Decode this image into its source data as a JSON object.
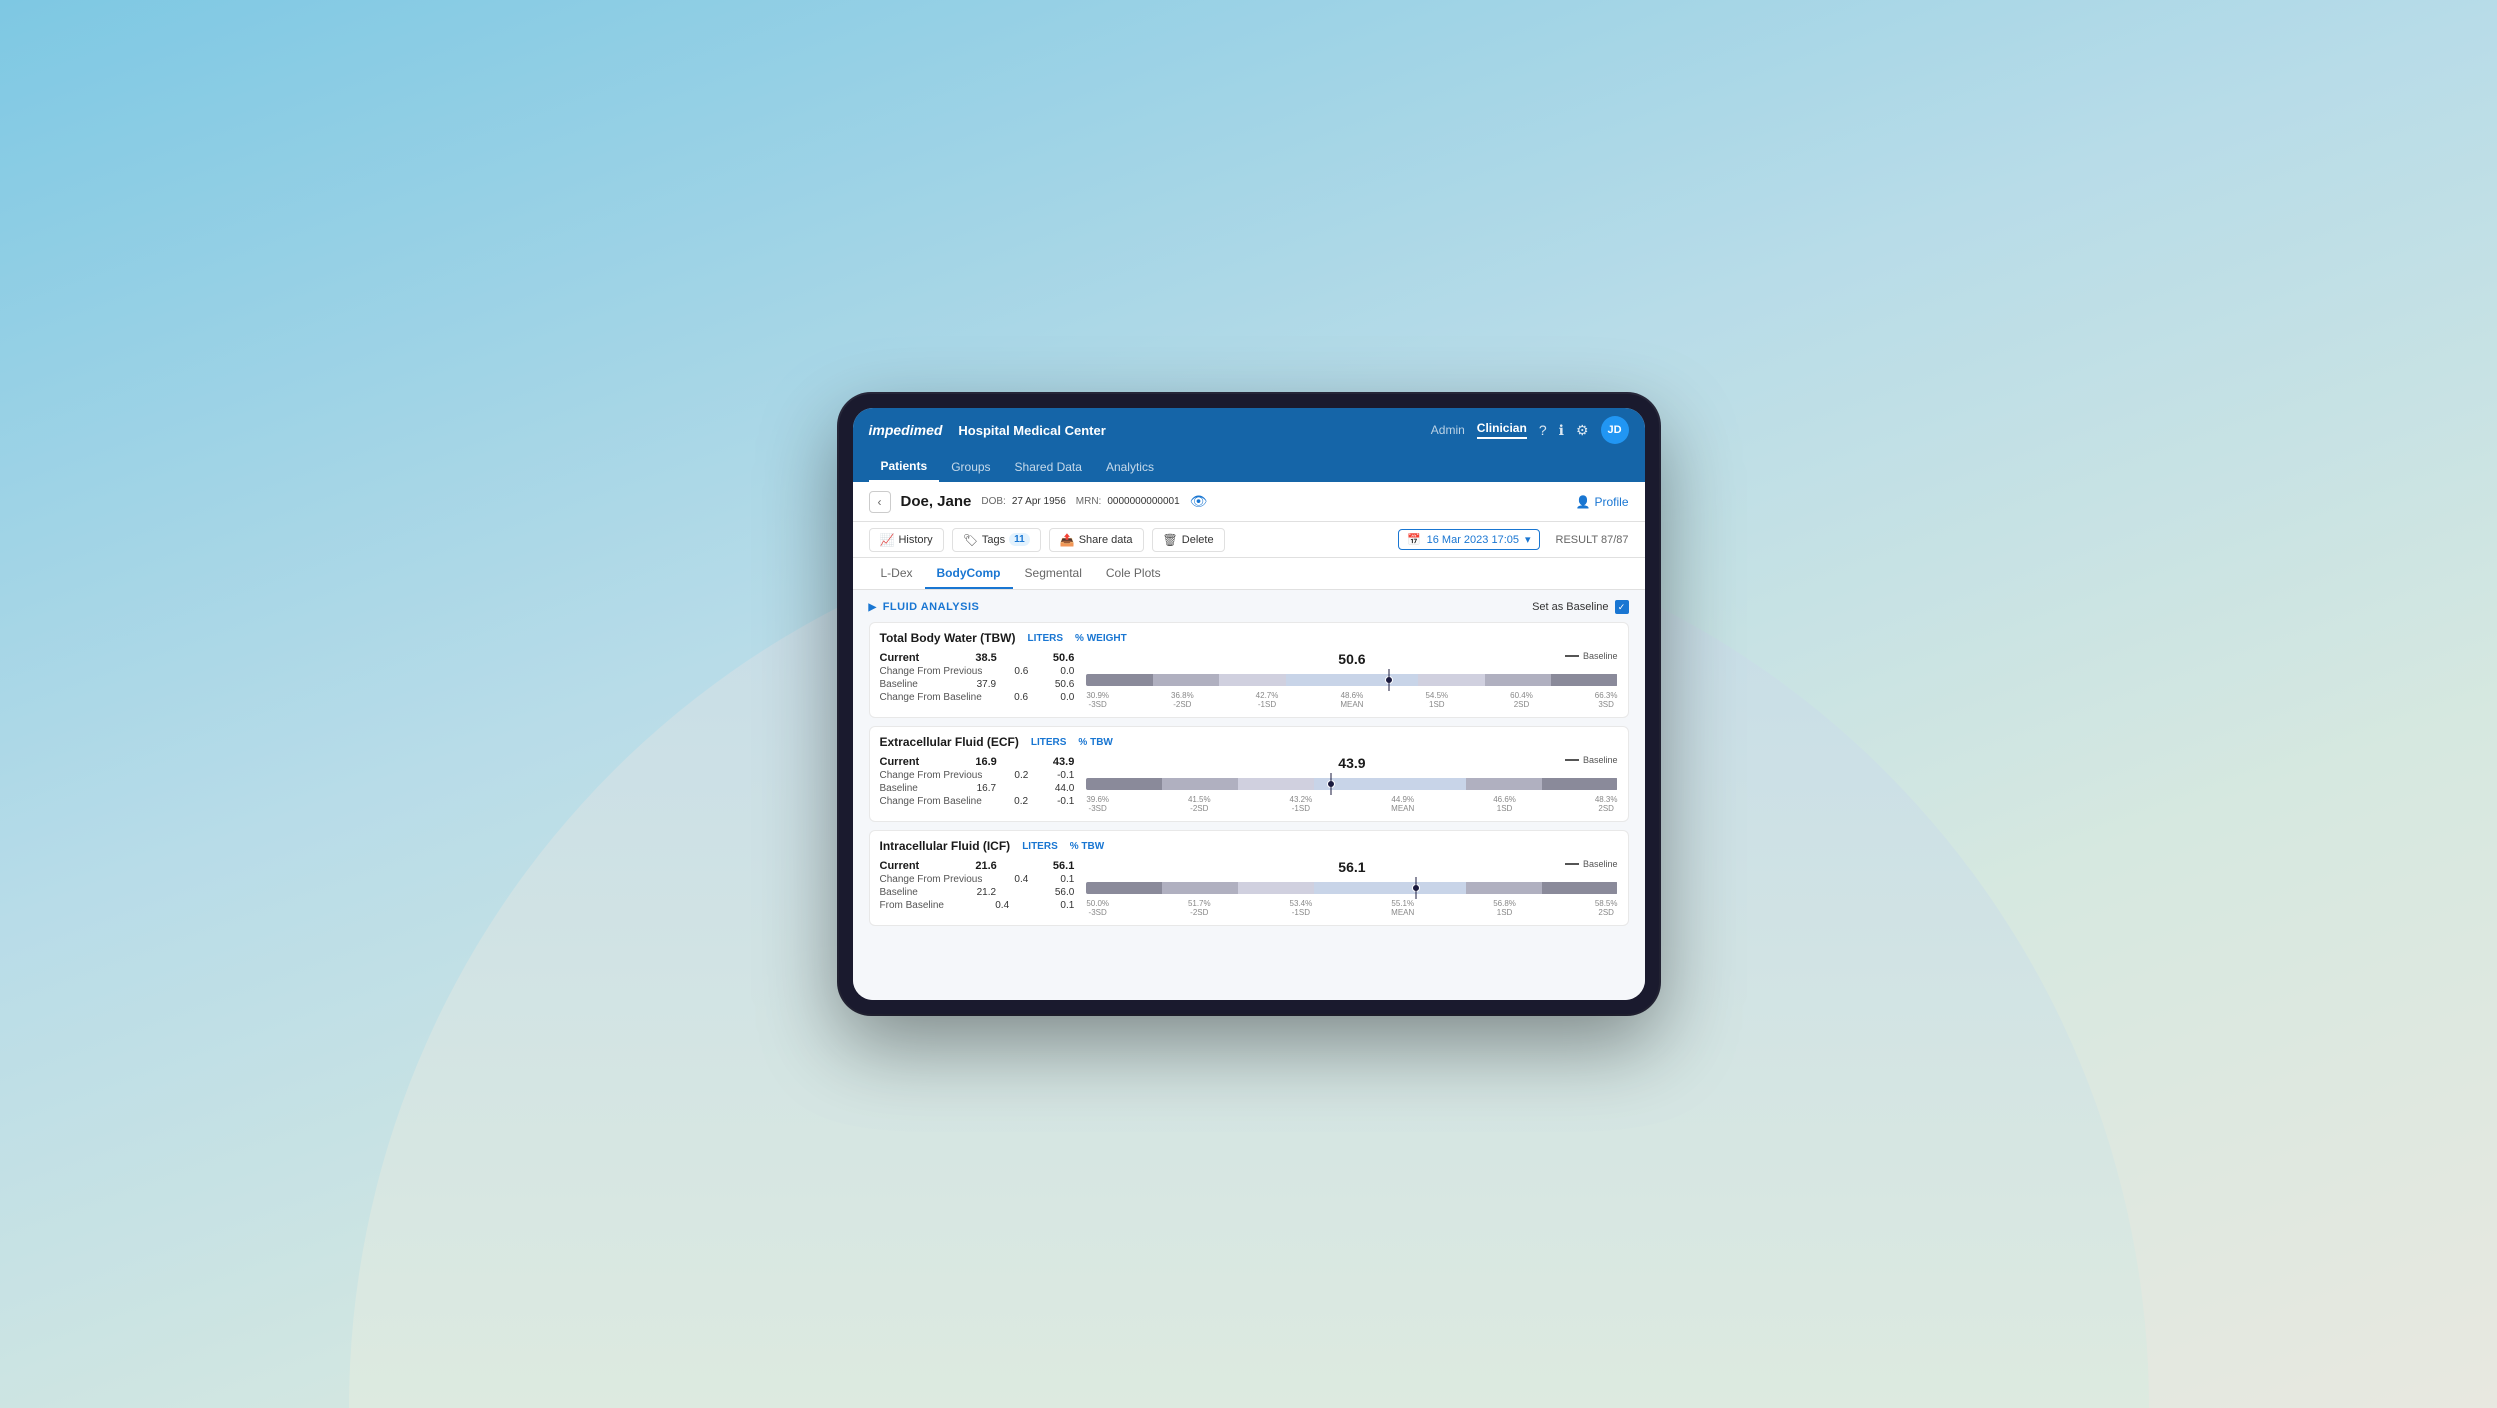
{
  "brand": "impedimed",
  "hospital": "Hospital Medical Center",
  "nav": {
    "admin_label": "Admin",
    "clinician_label": "Clinician",
    "avatar": "JD"
  },
  "main_tabs": [
    {
      "label": "Patients",
      "active": true
    },
    {
      "label": "Groups",
      "active": false
    },
    {
      "label": "Shared Data",
      "active": false
    },
    {
      "label": "Analytics",
      "active": false
    }
  ],
  "patient": {
    "name": "Doe, Jane",
    "dob_label": "DOB:",
    "dob": "27 Apr 1956",
    "mrn_label": "MRN:",
    "mrn": "0000000000001"
  },
  "profile_label": "Profile",
  "actions": {
    "history": "History",
    "tags": "Tags",
    "tags_count": "11",
    "share_data": "Share data",
    "delete": "Delete",
    "date": "16 Mar 2023 17:05",
    "result": "RESULT 87/87"
  },
  "sub_tabs": [
    "L-Dex",
    "BodyComp",
    "Segmental",
    "Cole Plots"
  ],
  "active_sub_tab": "BodyComp",
  "section": {
    "title": "FLUID ANALYSIS",
    "set_baseline": "Set as Baseline"
  },
  "tbw": {
    "title": "Total Body Water (TBW)",
    "unit1": "LITERS",
    "unit2": "% WEIGHT",
    "current_label": "Current",
    "current_liters": "38.5",
    "current_pct": "50.6",
    "change_prev_label": "Change From Previous",
    "change_prev_liters": "0.6",
    "change_prev_pct": "0.0",
    "baseline_label": "Baseline",
    "baseline_liters": "37.9",
    "baseline_pct": "50.6",
    "change_base_label": "Change From Baseline",
    "change_base_liters": "0.6",
    "change_base_pct": "0.0",
    "chart_value": "50.6",
    "dot_position": "57",
    "range_labels": [
      "30.9%",
      "36.8%",
      "42.7%",
      "48.6%",
      "54.5%",
      "60.4%",
      "66.3%"
    ],
    "range_sub": [
      "-3SD",
      "-2SD",
      "-1SD",
      "MEAN",
      "1SD",
      "2SD",
      "3SD"
    ]
  },
  "ecf": {
    "title": "Extracellular Fluid (ECF)",
    "unit1": "LITERS",
    "unit2": "% TBW",
    "current_label": "Current",
    "current_liters": "16.9",
    "current_pct": "43.9",
    "change_prev_label": "Change From Previous",
    "change_prev_liters": "0.2",
    "change_prev_pct": "-0.1",
    "baseline_label": "Baseline",
    "baseline_liters": "16.7",
    "baseline_pct": "44.0",
    "change_base_label": "Change From Baseline",
    "change_base_liters": "0.2",
    "change_base_pct": "-0.1",
    "chart_value": "43.9",
    "dot_position": "46",
    "range_labels": [
      "39.6%",
      "41.5%",
      "43.2%",
      "44.9%",
      "46.6%",
      "48.3%"
    ],
    "range_sub": [
      "-3SD",
      "-2SD",
      "-1SD",
      "MEAN",
      "1SD",
      "2SD"
    ]
  },
  "icf": {
    "title": "Intracellular Fluid (ICF)",
    "unit1": "LITERS",
    "unit2": "% TBW",
    "current_label": "Current",
    "current_liters": "21.6",
    "current_pct": "56.1",
    "change_prev_label": "Change From Previous",
    "change_prev_liters": "0.4",
    "change_prev_pct": "0.1",
    "baseline_label": "Baseline",
    "baseline_liters": "21.2",
    "baseline_pct": "56.0",
    "change_base_label": "From Baseline",
    "change_base_liters": "0.4",
    "change_base_pct": "0.1",
    "chart_value": "56.1",
    "dot_position": "62",
    "range_labels": [
      "50.0%",
      "51.7%",
      "53.4%",
      "55.1%",
      "56.8%",
      "58.5%"
    ],
    "range_sub": [
      "-3SD",
      "-2SD",
      "-1SD",
      "MEAN",
      "1SD",
      "2SD"
    ]
  },
  "baseline_legend": "Baseline"
}
